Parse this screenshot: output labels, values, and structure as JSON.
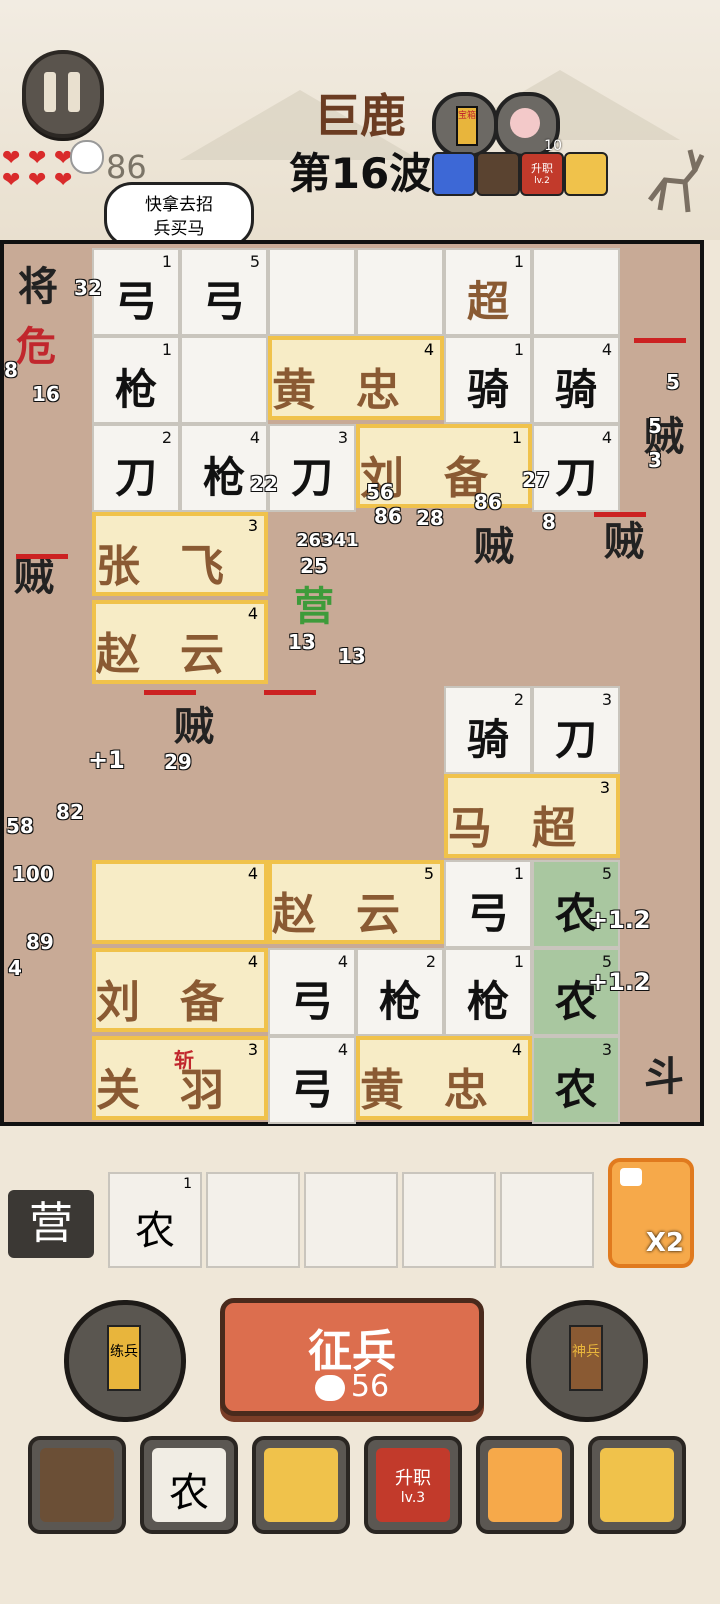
{
  "header": {
    "boss_name": "巨鹿",
    "wave": "第16波",
    "coins": "86",
    "tip_line1": "快拿去招",
    "tip_line2": "兵买马",
    "peach_count": "10",
    "rank_label": "升职",
    "rank_level": "lv.2",
    "top_badge": "宝箱"
  },
  "board": {
    "tiles": [
      {
        "ch": "弓",
        "lv": "1"
      },
      {
        "ch": "弓",
        "lv": "5"
      },
      {
        "ch": "超",
        "lv": "1"
      },
      {
        "ch": "枪",
        "lv": "1"
      },
      {
        "ch": "骑",
        "lv": "1"
      },
      {
        "ch": "骑",
        "lv": "4"
      },
      {
        "ch": "刀",
        "lv": "2"
      },
      {
        "ch": "枪",
        "lv": "4"
      },
      {
        "ch": "刀",
        "lv": "3"
      },
      {
        "ch": "刀",
        "lv": "4"
      },
      {
        "ch": "骑",
        "lv": "2"
      },
      {
        "ch": "刀",
        "lv": "3"
      },
      {
        "ch": "弓",
        "lv": "1"
      },
      {
        "ch": "农",
        "lv": "5"
      },
      {
        "ch": "弓",
        "lv": "4"
      },
      {
        "ch": "枪",
        "lv": "2"
      },
      {
        "ch": "枪",
        "lv": "1"
      },
      {
        "ch": "农",
        "lv": "5"
      },
      {
        "ch": "弓",
        "lv": "4"
      },
      {
        "ch": "农",
        "lv": "3"
      }
    ],
    "heroes": [
      {
        "name": "黄忠",
        "lv": "4"
      },
      {
        "name": "刘备",
        "lv": "1"
      },
      {
        "name": "张飞",
        "lv": "3"
      },
      {
        "name": "赵云",
        "lv": "4"
      },
      {
        "name": "马超",
        "lv": "3"
      },
      {
        "name": "",
        "lv": "4"
      },
      {
        "name": "赵云",
        "lv": "5"
      },
      {
        "name": "刘备",
        "lv": "4"
      },
      {
        "name": "关羽",
        "lv": "3"
      },
      {
        "name": "黄忠",
        "lv": "4"
      }
    ],
    "enemies": [
      "贼",
      "贼",
      "贼",
      "贼",
      "贼",
      "危",
      "斗",
      "将"
    ],
    "damage_numbers": [
      "32",
      "16",
      "22",
      "27",
      "56",
      "86",
      "28",
      "86",
      "8",
      "26341",
      "25",
      "13",
      "13",
      "29",
      "58",
      "82",
      "100",
      "89",
      "4",
      "5",
      "5",
      "3",
      "8"
    ],
    "gains": [
      "+1",
      "+1.2",
      "+1.2"
    ],
    "green_enemy": "营",
    "slash": "斩"
  },
  "bottom": {
    "camp_label": "营",
    "camp_slot_unit": "农",
    "camp_slot_lv": "1",
    "dig_multiplier": "X2",
    "recruit_label": "征兵",
    "recruit_cost": "56",
    "left_skill": "练兵",
    "right_skill": "神兵",
    "rank_level": "lv.3",
    "cards": [
      "potato",
      "农",
      "dig-gold",
      "升职",
      "fire-comet",
      "shovel"
    ]
  }
}
